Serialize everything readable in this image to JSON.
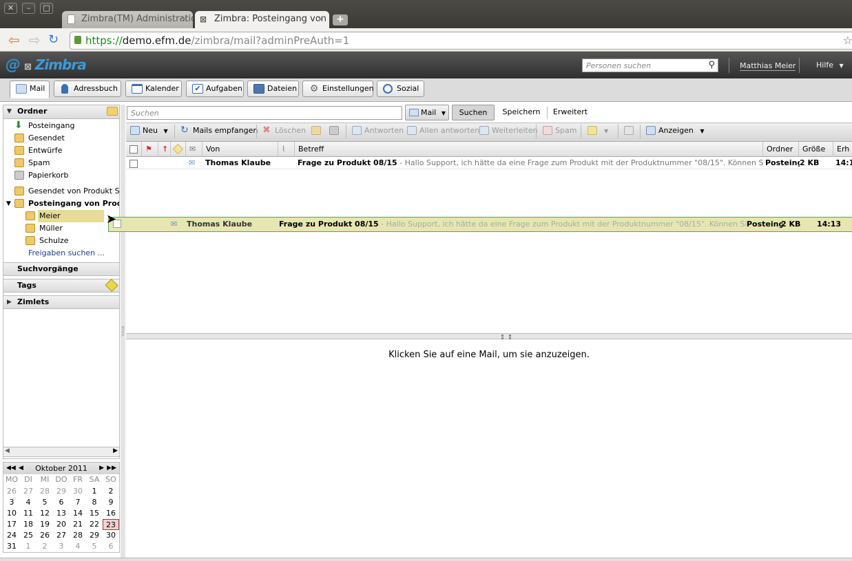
{
  "browser": {
    "tabs": [
      {
        "label": "Zimbra(TM) Administratio",
        "close": "✕"
      },
      {
        "label": "Zimbra: Posteingang von F",
        "close": "✕"
      }
    ],
    "new_tab": "+",
    "url": {
      "scheme": "https://",
      "host": "demo.efm.de",
      "path": "/zimbra/mail?adminPreAuth=1"
    }
  },
  "header": {
    "logo": "Zimbra",
    "people_search_placeholder": "Personen suchen",
    "user": "Matthias Meier",
    "help": "Hilfe"
  },
  "app_tabs": [
    {
      "label": "Mail"
    },
    {
      "label": "Adressbuch"
    },
    {
      "label": "Kalender"
    },
    {
      "label": "Aufgaben"
    },
    {
      "label": "Dateien"
    },
    {
      "label": "Einstellungen"
    },
    {
      "label": "Sozial"
    }
  ],
  "folders": {
    "title": "Ordner",
    "items": [
      {
        "label": "Posteingang"
      },
      {
        "label": "Gesendet"
      },
      {
        "label": "Entwürfe"
      },
      {
        "label": "Spam"
      },
      {
        "label": "Papierkorb"
      },
      {
        "label": "Gesendet von Produkt Sup"
      },
      {
        "label": "Posteingang von Produkt"
      },
      {
        "label": "Meier"
      },
      {
        "label": "Müller"
      },
      {
        "label": "Schulze"
      }
    ],
    "find_shares": "Freigaben suchen ..."
  },
  "sections": {
    "searches": "Suchvorgänge",
    "tags": "Tags",
    "zimlets": "Zimlets"
  },
  "calendar": {
    "month": "Oktober 2011",
    "weekdays": [
      "MO",
      "DI",
      "MI",
      "DO",
      "FR",
      "SA",
      "SO"
    ],
    "weeks": [
      [
        "26",
        "27",
        "28",
        "29",
        "30",
        "1",
        "2"
      ],
      [
        "3",
        "4",
        "5",
        "6",
        "7",
        "8",
        "9"
      ],
      [
        "10",
        "11",
        "12",
        "13",
        "14",
        "15",
        "16"
      ],
      [
        "17",
        "18",
        "19",
        "20",
        "21",
        "22",
        "23"
      ],
      [
        "24",
        "25",
        "26",
        "27",
        "28",
        "29",
        "30"
      ],
      [
        "31",
        "1",
        "2",
        "3",
        "4",
        "5",
        "6"
      ]
    ],
    "today": "23"
  },
  "search": {
    "placeholder": "Suchen",
    "scope": "Mail",
    "search_button": "Suchen",
    "save_button": "Speichern",
    "advanced_button": "Erweitert"
  },
  "toolbar": {
    "new": "Neu",
    "get_mail": "Mails empfangen",
    "delete": "Löschen",
    "reply": "Antworten",
    "reply_all": "Allen antworten",
    "forward": "Weiterleiten",
    "spam": "Spam",
    "view": "Anzeigen"
  },
  "list_header": {
    "from": "Von",
    "subject": "Betreff",
    "folder": "Ordner",
    "size": "Größe",
    "received": "Erh"
  },
  "messages": [
    {
      "from": "Thomas Klaube",
      "subject": "Frage zu Produkt 08/15",
      "fragment": " - Hallo Support, ich hätte da eine Frage zum Produkt mit der Produktnummer \"08/15\". Können Sie mir das weiterhe",
      "folder": "Posteing",
      "size": "2 KB",
      "time": "14:13"
    }
  ],
  "drag": {
    "from": "Thomas Klaube",
    "subject": "Frage zu Produkt 08/15",
    "fragment": " - Hallo Support, ich hätte da eine Frage zum Produkt mit der Produktnummer \"08/15\". Können Sie mir das weiterhel",
    "folder": "Posteinga",
    "size": "2 KB",
    "time": "14:13"
  },
  "reading_pane": {
    "message": "Klicken Sie auf eine Mail, um sie anzuzeigen."
  }
}
